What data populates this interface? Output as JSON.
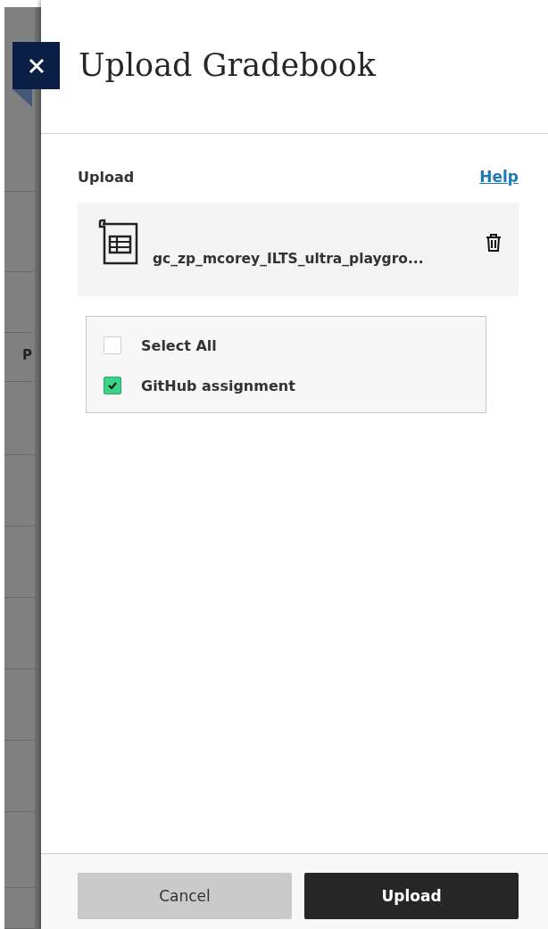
{
  "background": {
    "cut_text": "P"
  },
  "panel": {
    "title": "Upload Gradebook",
    "section_label": "Upload",
    "help_link": "Help",
    "file": {
      "name": "gc_zp_mcorey_ILTS_ultra_playgro..."
    },
    "columns": [
      {
        "label": "Select All",
        "checked": false
      },
      {
        "label": "GitHub assignment",
        "checked": true
      }
    ],
    "buttons": {
      "cancel": "Cancel",
      "upload": "Upload"
    }
  }
}
